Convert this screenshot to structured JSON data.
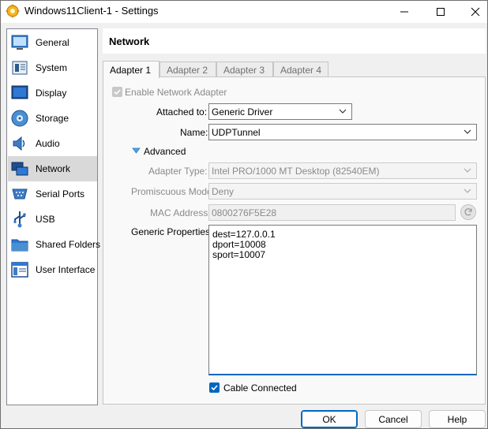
{
  "window": {
    "title": "Windows11Client-1 - Settings"
  },
  "sidebar": {
    "items": [
      {
        "label": "General",
        "icon": "general-icon"
      },
      {
        "label": "System",
        "icon": "system-icon"
      },
      {
        "label": "Display",
        "icon": "display-icon"
      },
      {
        "label": "Storage",
        "icon": "storage-icon"
      },
      {
        "label": "Audio",
        "icon": "audio-icon"
      },
      {
        "label": "Network",
        "icon": "network-icon",
        "selected": true
      },
      {
        "label": "Serial Ports",
        "icon": "serial-ports-icon"
      },
      {
        "label": "USB",
        "icon": "usb-icon"
      },
      {
        "label": "Shared Folders",
        "icon": "shared-folders-icon"
      },
      {
        "label": "User Interface",
        "icon": "user-interface-icon"
      }
    ]
  },
  "header": {
    "title": "Network"
  },
  "tabs": [
    {
      "label": "Adapter 1",
      "active": true
    },
    {
      "label": "Adapter 2"
    },
    {
      "label": "Adapter 3"
    },
    {
      "label": "Adapter 4"
    }
  ],
  "adapter": {
    "enable_label": "Enable Network Adapter",
    "attached_label": "Attached to:",
    "attached_value": "Generic Driver",
    "name_label": "Name:",
    "name_value": "UDPTunnel",
    "advanced_label": "Advanced",
    "adapter_type_label": "Adapter Type:",
    "adapter_type_value": "Intel PRO/1000 MT Desktop (82540EM)",
    "promiscuous_label": "Promiscuous Mode:",
    "promiscuous_value": "Deny",
    "mac_label": "MAC Address:",
    "mac_value": "0800276F5E28",
    "generic_props_label": "Generic Properties:",
    "generic_props_lines": [
      "dest=127.0.0.1",
      "dport=10008",
      "sport=10007"
    ],
    "cable_label": "Cable Connected"
  },
  "buttons": {
    "ok": "OK",
    "cancel": "Cancel",
    "help": "Help"
  },
  "colors": {
    "accent": "#0067c0",
    "selected_nav": "#d9d9d9"
  }
}
